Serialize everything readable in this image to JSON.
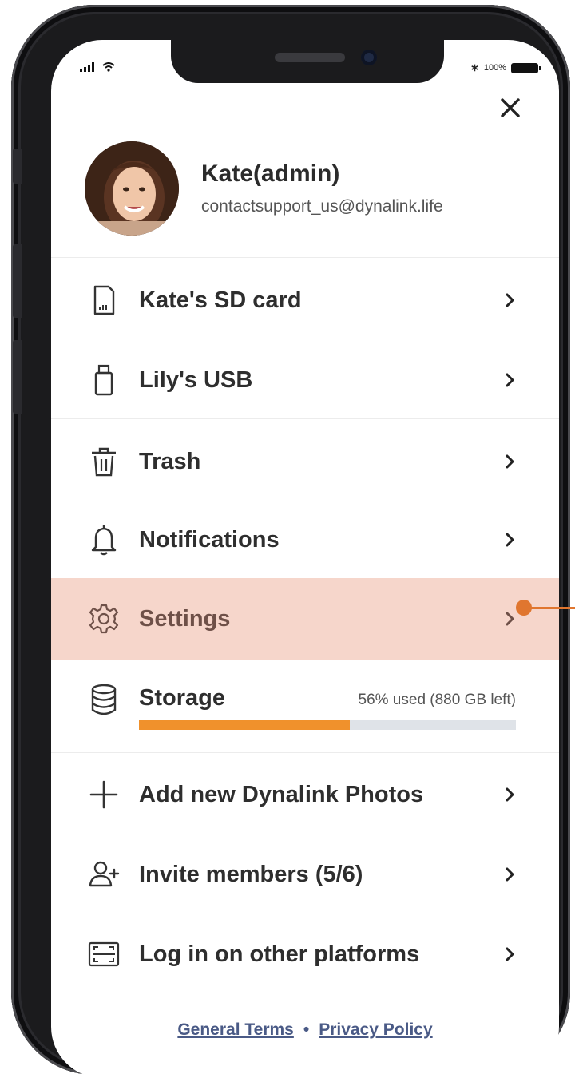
{
  "status_bar": {
    "battery_text": "100%"
  },
  "profile": {
    "name": "Kate(admin)",
    "email": "contactsupport_us@dynalink.life"
  },
  "menu": {
    "sd_card": "Kate's SD card",
    "usb": "Lily's USB",
    "trash": "Trash",
    "notifications": "Notifications",
    "settings": "Settings",
    "storage": "Storage",
    "storage_used": "56% used (880 GB left)",
    "storage_percent": 56,
    "add_photos": "Add new Dynalink Photos",
    "invite": "Invite members (5/6)",
    "login_other": "Log in on other platforms"
  },
  "footer": {
    "terms": "General Terms",
    "separator": "•",
    "privacy": "Privacy Policy"
  },
  "colors": {
    "highlight": "#f6d6cb",
    "accent": "#f0912c",
    "annotation": "#e0762f",
    "link": "#4a5a86"
  },
  "icons": [
    "close-icon",
    "sd-card-icon",
    "usb-icon",
    "trash-icon",
    "bell-icon",
    "gear-icon",
    "database-icon",
    "plus-icon",
    "add-user-icon",
    "scan-icon",
    "chevron-right-icon"
  ]
}
